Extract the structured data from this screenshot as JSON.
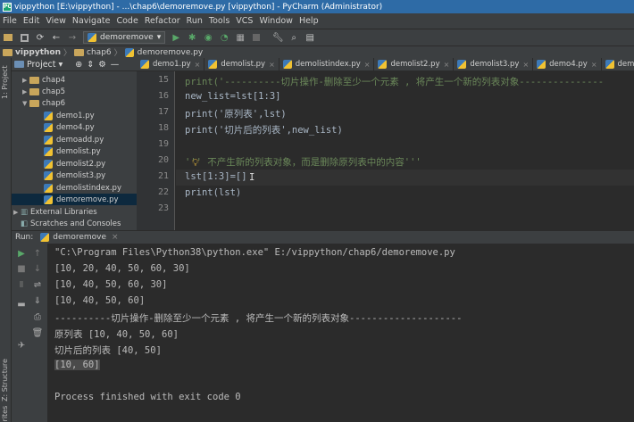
{
  "window": {
    "title": "vippython [E:\\vippython] - ...\\chap6\\demoremove.py [vippython] - PyCharm (Administrator)"
  },
  "menu": [
    "File",
    "Edit",
    "View",
    "Navigate",
    "Code",
    "Refactor",
    "Run",
    "Tools",
    "VCS",
    "Window",
    "Help"
  ],
  "toolbar": {
    "run_config": "demoremove"
  },
  "breadcrumb": [
    "vippython",
    "chap6",
    "demoremove.py"
  ],
  "project": {
    "header": "Project",
    "items": [
      {
        "label": "chap4",
        "kind": "folder"
      },
      {
        "label": "chap5",
        "kind": "folder"
      },
      {
        "label": "chap6",
        "kind": "folder"
      },
      {
        "label": "demo1.py",
        "kind": "file"
      },
      {
        "label": "demo4.py",
        "kind": "file"
      },
      {
        "label": "demoadd.py",
        "kind": "file"
      },
      {
        "label": "demolist.py",
        "kind": "file"
      },
      {
        "label": "demolist2.py",
        "kind": "file"
      },
      {
        "label": "demolist3.py",
        "kind": "file"
      },
      {
        "label": "demolistindex.py",
        "kind": "file"
      },
      {
        "label": "demoremove.py",
        "kind": "file"
      },
      {
        "label": "External Libraries",
        "kind": "lib"
      },
      {
        "label": "Scratches and Consoles",
        "kind": "scratch"
      }
    ]
  },
  "tabs": [
    "demo1.py",
    "demolist.py",
    "demolistindex.py",
    "demolist2.py",
    "demolist3.py",
    "demo4.py",
    "demoadd.py"
  ],
  "editor": {
    "line_numbers": [
      "15",
      "16",
      "17",
      "18",
      "19",
      "20",
      "21",
      "22",
      "23"
    ],
    "lines": [
      "print('----------切片操作-删除至少一个元素 , 将产生一个新的列表对象---------------",
      "new_list=lst[1:3]",
      "print('原列表',lst)",
      "print('切片后的列表',new_list)",
      "",
      "''' 不产生新的列表对象，而是删除原列表中的内容'''",
      "lst[1:3]=[]",
      "print(lst)",
      ""
    ]
  },
  "run": {
    "label": "Run:",
    "tab": "demoremove",
    "output": [
      "\"C:\\Program Files\\Python38\\python.exe\" E:/vippython/chap6/demoremove.py",
      "[10, 20, 40, 50, 60, 30]",
      "[10, 40, 50, 60, 30]",
      "[10, 40, 50, 60]",
      "----------切片操作-删除至少一个元素 , 将产生一个新的列表对象--------------------",
      "原列表 [10, 40, 50, 60]",
      "切片后的列表 [40, 50]",
      "[10, 60]",
      "",
      "Process finished with exit code 0"
    ]
  },
  "sidebar_tabs": {
    "project": "1: Project",
    "structure": "Z: Structure",
    "favorites": "avorites"
  }
}
